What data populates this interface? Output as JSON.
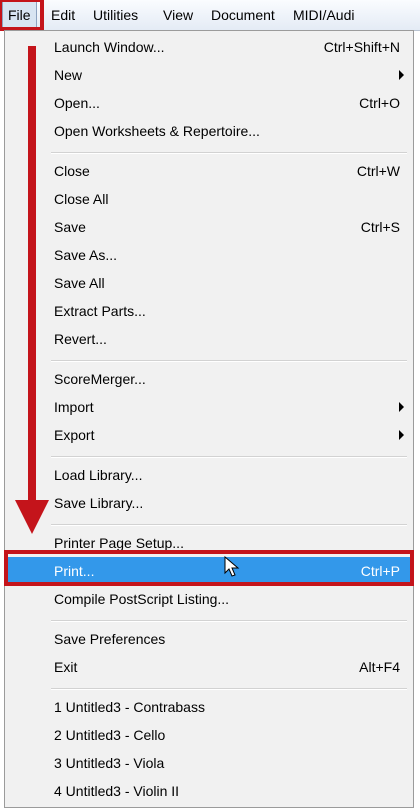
{
  "menubar": {
    "items": [
      "File",
      "Edit",
      "Utilities",
      "View",
      "Document",
      "MIDI/Audi"
    ]
  },
  "menu": {
    "items": [
      {
        "label": "Launch Window...",
        "shortcut": "Ctrl+Shift+N"
      },
      {
        "label": "New",
        "submenu": true
      },
      {
        "label": "Open...",
        "shortcut": "Ctrl+O"
      },
      {
        "label": "Open Worksheets & Repertoire..."
      },
      {
        "label": "Close",
        "shortcut": "Ctrl+W"
      },
      {
        "label": "Close All"
      },
      {
        "label": "Save",
        "shortcut": "Ctrl+S"
      },
      {
        "label": "Save As..."
      },
      {
        "label": "Save All"
      },
      {
        "label": "Extract Parts..."
      },
      {
        "label": "Revert..."
      },
      {
        "label": "ScoreMerger..."
      },
      {
        "label": "Import",
        "submenu": true
      },
      {
        "label": "Export",
        "submenu": true
      },
      {
        "label": "Load Library..."
      },
      {
        "label": "Save Library..."
      },
      {
        "label": "Printer Page Setup..."
      },
      {
        "label": "Print...",
        "shortcut": "Ctrl+P",
        "selected": true
      },
      {
        "label": "Compile PostScript Listing..."
      },
      {
        "label": "Save Preferences"
      },
      {
        "label": "Exit",
        "shortcut": "Alt+F4"
      },
      {
        "label": "1 Untitled3 - Contrabass"
      },
      {
        "label": "2 Untitled3 - Cello"
      },
      {
        "label": "3 Untitled3 - Viola"
      },
      {
        "label": "4 Untitled3 - Violin II"
      }
    ]
  },
  "colors": {
    "highlight": "#3398ea",
    "annotation": "#c4141b"
  }
}
